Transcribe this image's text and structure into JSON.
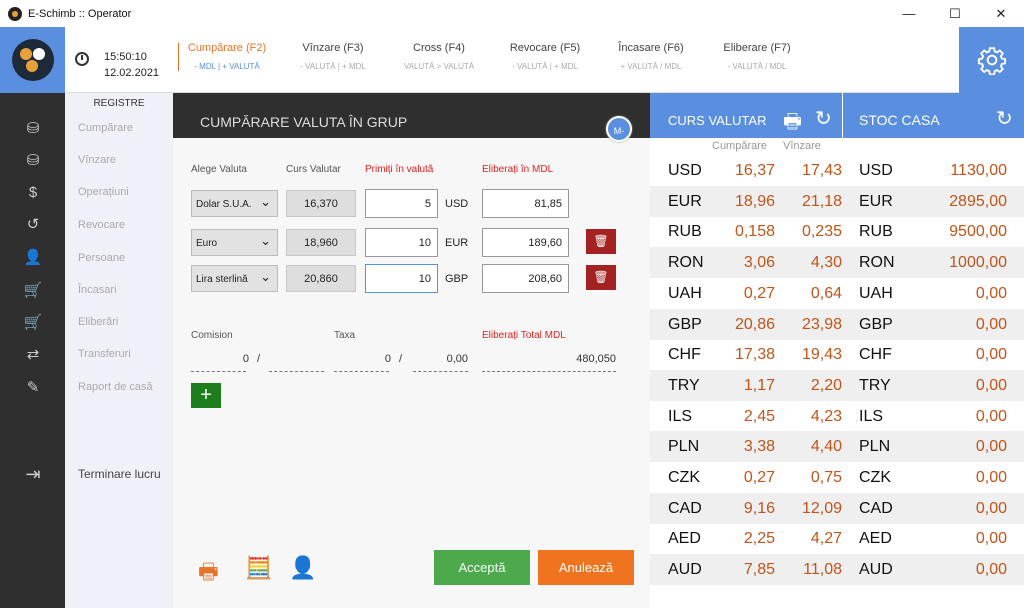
{
  "window": {
    "title": "E-Schimb :: Operator",
    "min": "—",
    "max": "☐",
    "close": "✕"
  },
  "header": {
    "time": "15:50:10",
    "date": "12.02.2021",
    "tabs": [
      {
        "label": "Cumpărare (F2)",
        "sub": "- MDL | + VALUTĂ"
      },
      {
        "label": "Vînzare (F3)",
        "sub": "- VALUTĂ | + MDL"
      },
      {
        "label": "Cross (F4)",
        "sub": "VALUTĂ > VALUTĂ"
      },
      {
        "label": "Revocare (F5)",
        "sub": "- VALUTĂ | + MDL"
      },
      {
        "label": "Încasare (F6)",
        "sub": "+ VALUTĂ / MDL"
      },
      {
        "label": "Eliberare (F7)",
        "sub": "- VALUTĂ / MDL"
      }
    ]
  },
  "menu": {
    "head": "REGISTRE",
    "items": [
      "Cumpărare",
      "Vînzare",
      "Operațiuni",
      "Revocare",
      "Persoane",
      "Încasari",
      "Eliberări",
      "Transferuri",
      "Raport de casă"
    ],
    "end": "Terminare lucru"
  },
  "form": {
    "title": "CUMPĂRARE VALUTA ÎN GRUP",
    "badge": "M-",
    "cols": {
      "currency": "Alege Valuta",
      "rate": "Curs Valutar",
      "receive": "Primiți în valută",
      "pay": "Eliberați în MDL"
    },
    "rows": [
      {
        "name": "Dolar S.U.A.",
        "rate": "16,370",
        "amount": "5",
        "code": "USD",
        "mdl": "81,85"
      },
      {
        "name": "Euro",
        "rate": "18,960",
        "amount": "10",
        "code": "EUR",
        "mdl": "189,60"
      },
      {
        "name": "Lira sterlină",
        "rate": "20,860",
        "amount": "10",
        "code": "GBP",
        "mdl": "208,60"
      }
    ],
    "commission_label": "Comision",
    "commission_a": "0",
    "commission_sep": "/",
    "tax_label": "Taxa",
    "tax_a": "0",
    "tax_sep": "/",
    "tax_b": "0,00",
    "total_label": "Eliberați Total MDL",
    "total": "480,050",
    "accept": "Acceptă",
    "cancel": "Anulează",
    "colors": {
      "accept": "#4caa4c",
      "cancel": "#f07420"
    }
  },
  "rates": {
    "title": "CURS VALUTAR",
    "stock_title": "STOC CASA",
    "buy": "Cumpărare",
    "sell": "Vînzare",
    "rows": [
      [
        "USD",
        "16,37",
        "17,43",
        "1130,00"
      ],
      [
        "EUR",
        "18,96",
        "21,18",
        "2895,00"
      ],
      [
        "RUB",
        "0,158",
        "0,235",
        "9500,00"
      ],
      [
        "RON",
        "3,06",
        "4,30",
        "1000,00"
      ],
      [
        "UAH",
        "0,27",
        "0,64",
        "0,00"
      ],
      [
        "GBP",
        "20,86",
        "23,98",
        "0,00"
      ],
      [
        "CHF",
        "17,38",
        "19,43",
        "0,00"
      ],
      [
        "TRY",
        "1,17",
        "2,20",
        "0,00"
      ],
      [
        "ILS",
        "2,45",
        "4,23",
        "0,00"
      ],
      [
        "PLN",
        "3,38",
        "4,40",
        "0,00"
      ],
      [
        "CZK",
        "0,27",
        "0,75",
        "0,00"
      ],
      [
        "CAD",
        "9,16",
        "12,09",
        "0,00"
      ],
      [
        "AED",
        "2,25",
        "4,27",
        "0,00"
      ],
      [
        "AUD",
        "7,85",
        "11,08",
        "0,00"
      ]
    ]
  }
}
